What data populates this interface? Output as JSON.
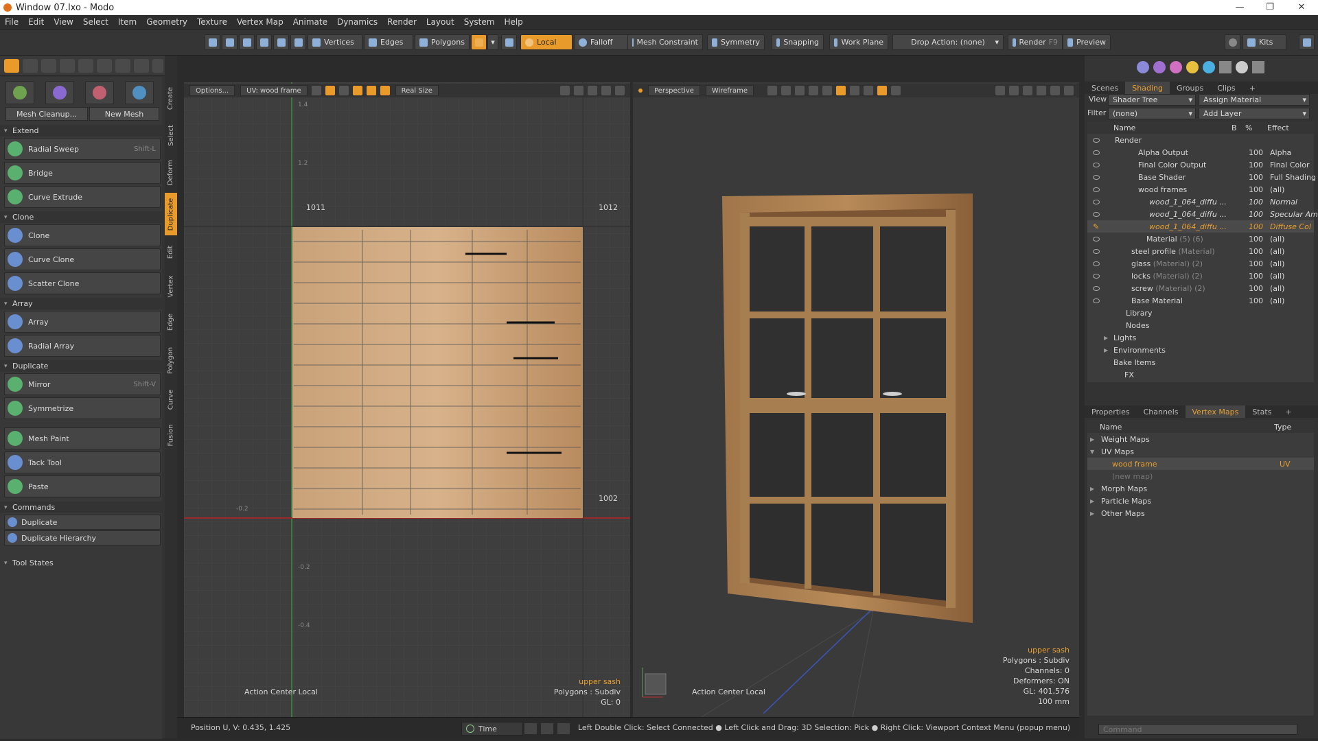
{
  "window": {
    "title": "Window 07.lxo - Modo"
  },
  "menu": [
    "File",
    "Edit",
    "View",
    "Select",
    "Item",
    "Geometry",
    "Texture",
    "Vertex Map",
    "Animate",
    "Dynamics",
    "Render",
    "Layout",
    "System",
    "Help"
  ],
  "toolbar": {
    "vertices": "Vertices",
    "edges": "Edges",
    "polygons": "Polygons",
    "local": "Local",
    "falloff": "Falloff",
    "mesh_constraint": "Mesh Constraint",
    "symmetry": "Symmetry",
    "snapping": "Snapping",
    "work_plane": "Work Plane",
    "drop_action": "Drop Action: (none)",
    "render": "Render",
    "render_key": "F9",
    "preview": "Preview",
    "kits": "Kits"
  },
  "left": {
    "mesh_cleanup": "Mesh Cleanup...",
    "new_mesh": "New Mesh",
    "sections": {
      "extend": "Extend",
      "clone": "Clone",
      "array": "Array",
      "duplicate": "Duplicate",
      "commands": "Commands",
      "tool_states": "Tool States"
    },
    "tools": {
      "radial_sweep": "Radial Sweep",
      "radial_sweep_sc": "Shift-L",
      "bridge": "Bridge",
      "curve_extrude": "Curve Extrude",
      "clone": "Clone",
      "curve_clone": "Curve Clone",
      "scatter_clone": "Scatter Clone",
      "array": "Array",
      "radial_array": "Radial Array",
      "mirror": "Mirror",
      "mirror_sc": "Shift-V",
      "symmetrize": "Symmetrize",
      "mesh_paint": "Mesh Paint",
      "tack_tool": "Tack Tool",
      "paste": "Paste"
    },
    "commands": {
      "duplicate": "Duplicate",
      "duplicate_hierarchy": "Duplicate Hierarchy"
    }
  },
  "vtabs": [
    "Create",
    "Select",
    "Deform",
    "Duplicate",
    "Edit",
    "Vertex",
    "Edge",
    "Polygon",
    "Curve",
    "Fusion"
  ],
  "uv": {
    "options": "Options...",
    "uvmap": "UV: wood frame",
    "realsize": "Real Size",
    "tile_tl": "1011",
    "tile_tr": "1012",
    "tile_br": "1002",
    "ruler": [
      "1.4",
      "1.2",
      "-0.2",
      "-0.2",
      "-0.4"
    ],
    "action_center": "Action Center Local",
    "info_item": "upper sash",
    "info_poly": "Polygons : Subdiv",
    "info_gl": "GL: 0"
  },
  "p3d": {
    "perspective": "Perspective",
    "wireframe": "Wireframe",
    "action_center": "Action Center Local",
    "info_item": "upper sash",
    "info_poly": "Polygons : Subdiv",
    "info_channels": "Channels: 0",
    "info_deformers": "Deformers: ON",
    "info_gl": "GL: 401,576",
    "info_size": "100 mm"
  },
  "status": {
    "position": "Position U, V:  0.435, 1.425",
    "time": "Time",
    "hint": "Left Double Click: Select Connected ● Left Click and Drag: 3D Selection: Pick ● Right Click: Viewport Context Menu (popup menu) ● Right Click and..."
  },
  "right": {
    "top_tabs": [
      "Scenes",
      "Shading",
      "Groups",
      "Clips"
    ],
    "view_label": "View",
    "view_value": "Shader Tree",
    "assign": "Assign Material",
    "filter_label": "Filter",
    "filter_value": "(none)",
    "add_layer": "Add Layer",
    "cols": {
      "name": "Name",
      "b": "B",
      "pct": "%",
      "effect": "Effect"
    },
    "rows": [
      {
        "name": "Render",
        "pct": "",
        "eff": ""
      },
      {
        "name": "Alpha Output",
        "pct": "100",
        "eff": "Alpha"
      },
      {
        "name": "Final Color Output",
        "pct": "100",
        "eff": "Final Color"
      },
      {
        "name": "Base Shader",
        "pct": "100",
        "eff": "Full Shading"
      },
      {
        "name": "wood frames",
        "pct": "100",
        "eff": "(all)"
      },
      {
        "name": "wood_1_064_diffu ...",
        "pct": "100",
        "eff": "Normal"
      },
      {
        "name": "wood_1_064_diffu ...",
        "pct": "100",
        "eff": "Specular Am"
      },
      {
        "name": "wood_1_064_diffu ...",
        "pct": "100",
        "eff": "Diffuse Col"
      },
      {
        "name": "Material",
        "mat": "(5) (6)",
        "pct": "100",
        "eff": "(all)"
      },
      {
        "name": "steel profile",
        "mat": "(Material)",
        "pct": "100",
        "eff": "(all)"
      },
      {
        "name": "glass",
        "mat": "(Material) (2)",
        "pct": "100",
        "eff": "(all)"
      },
      {
        "name": "locks",
        "mat": "(Material) (2)",
        "pct": "100",
        "eff": "(all)"
      },
      {
        "name": "screw",
        "mat": "(Material) (2)",
        "pct": "100",
        "eff": "(all)"
      },
      {
        "name": "Base Material",
        "pct": "100",
        "eff": "(all)"
      },
      {
        "name": "Library",
        "pct": "",
        "eff": ""
      },
      {
        "name": "Nodes",
        "pct": "",
        "eff": ""
      },
      {
        "name": "Lights",
        "pct": "",
        "eff": ""
      },
      {
        "name": "Environments",
        "pct": "",
        "eff": ""
      },
      {
        "name": "Bake Items",
        "pct": "",
        "eff": ""
      },
      {
        "name": "FX",
        "pct": "",
        "eff": ""
      }
    ],
    "bottom_tabs": [
      "Properties",
      "Channels",
      "Vertex Maps",
      "Stats"
    ],
    "vm_cols": {
      "name": "Name",
      "type": "Type"
    },
    "vm_rows": [
      {
        "name": "Weight Maps",
        "type": ""
      },
      {
        "name": "UV Maps",
        "type": ""
      },
      {
        "name": "wood frame",
        "type": "UV"
      },
      {
        "name": "(new map)",
        "type": ""
      },
      {
        "name": "Morph Maps",
        "type": ""
      },
      {
        "name": "Particle Maps",
        "type": ""
      },
      {
        "name": "Other Maps",
        "type": ""
      }
    ],
    "command_placeholder": "Command"
  }
}
